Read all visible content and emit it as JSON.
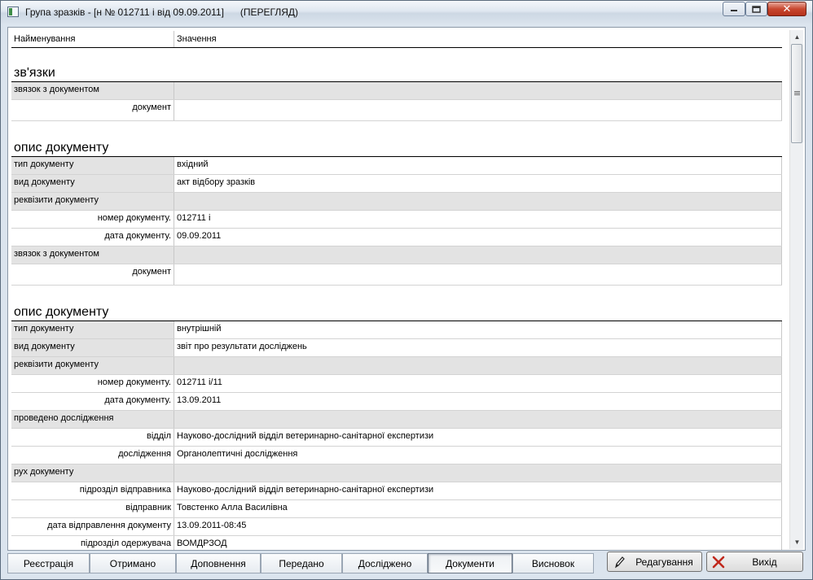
{
  "window": {
    "title": "Група зразків - [н № 012711 і від 09.09.2011]",
    "mode": "(ПЕРЕГЛЯД)",
    "close_label": "✕"
  },
  "grid": {
    "col_name": "Найменування",
    "col_value": "Значення"
  },
  "sections": [
    {
      "title": "зв'язки",
      "rows": [
        {
          "name": "звязок з документом",
          "value": "",
          "kind": "group"
        },
        {
          "name": "документ",
          "value": "",
          "kind": "sub",
          "tall": true
        }
      ]
    },
    {
      "title": "опис документу",
      "rows": [
        {
          "name": "тип документу",
          "value": "вхідний",
          "kind": "item"
        },
        {
          "name": "вид документу",
          "value": "акт відбору зразків",
          "kind": "item"
        },
        {
          "name": "реквізити документу",
          "value": "",
          "kind": "group"
        },
        {
          "name": "номер документу.",
          "value": "012711 і",
          "kind": "sub"
        },
        {
          "name": "дата документу.",
          "value": "09.09.2011",
          "kind": "sub"
        },
        {
          "name": "звязок з документом",
          "value": "",
          "kind": "group"
        },
        {
          "name": "документ",
          "value": "",
          "kind": "sub",
          "tall": true
        }
      ]
    },
    {
      "title": "опис документу",
      "rows": [
        {
          "name": "тип документу",
          "value": "внутрішній",
          "kind": "item"
        },
        {
          "name": "вид документу",
          "value": "звіт про результати досліджень",
          "kind": "item"
        },
        {
          "name": "реквізити документу",
          "value": "",
          "kind": "group"
        },
        {
          "name": "номер документу.",
          "value": "012711 і/11",
          "kind": "sub"
        },
        {
          "name": "дата документу.",
          "value": "13.09.2011",
          "kind": "sub"
        },
        {
          "name": "проведено дослідження",
          "value": "",
          "kind": "group"
        },
        {
          "name": "відділ",
          "value": "Науково-дослідний відділ ветеринарно-санітарної експертизи",
          "kind": "sub"
        },
        {
          "name": "дослідження",
          "value": "Органолептичні дослідження",
          "kind": "sub"
        },
        {
          "name": "рух документу",
          "value": "",
          "kind": "group"
        },
        {
          "name": "підрозділ відправника",
          "value": "Науково-дослідний відділ ветеринарно-санітарної експертизи",
          "kind": "sub"
        },
        {
          "name": "відправник",
          "value": "Товстенко Алла Василівна",
          "kind": "sub"
        },
        {
          "name": "дата відправлення документу",
          "value": "13.09.2011-08:45",
          "kind": "sub"
        },
        {
          "name": "підрозділ одержувача",
          "value": "ВОМДРЗОД",
          "kind": "sub"
        }
      ]
    }
  ],
  "tabs": [
    {
      "label": "Реєстрація",
      "active": false
    },
    {
      "label": "Отримано",
      "active": false
    },
    {
      "label": "Доповнення",
      "active": false
    },
    {
      "label": "Передано",
      "active": false
    },
    {
      "label": "Досліджено",
      "active": false
    },
    {
      "label": "Документи",
      "active": true
    },
    {
      "label": "Висновок",
      "active": false
    }
  ],
  "actions": {
    "edit_label": "Редагування",
    "edit_icon": "pencil-icon",
    "exit_label": "Вихід",
    "exit_icon": "x-mark-icon",
    "exit_icon_color": "#c0281c"
  }
}
